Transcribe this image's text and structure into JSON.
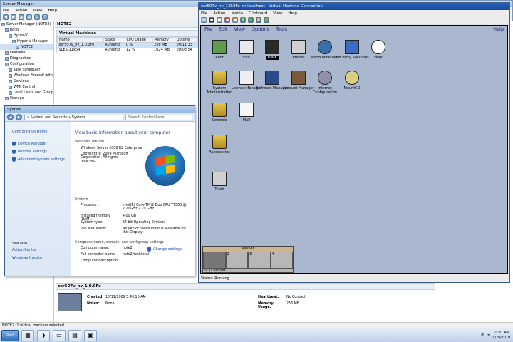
{
  "server_manager": {
    "title": "Server Manager",
    "menu": [
      "File",
      "Action",
      "View",
      "Help"
    ],
    "tree": [
      {
        "label": "Server Manager (NOTE2)",
        "indent": 0
      },
      {
        "label": "Roles",
        "indent": 1
      },
      {
        "label": "Hyper-V",
        "indent": 2
      },
      {
        "label": "Hyper-V Manager",
        "indent": 3
      },
      {
        "label": "NOTE2",
        "indent": 4
      },
      {
        "label": "Features",
        "indent": 1
      },
      {
        "label": "Diagnostics",
        "indent": 1
      },
      {
        "label": "Configuration",
        "indent": 1
      },
      {
        "label": "Task Scheduler",
        "indent": 2
      },
      {
        "label": "Windows Firewall with",
        "indent": 2
      },
      {
        "label": "Services",
        "indent": 2
      },
      {
        "label": "WMI Control",
        "indent": 2
      },
      {
        "label": "Local Users and Group",
        "indent": 2
      },
      {
        "label": "Storage",
        "indent": 1
      }
    ],
    "main_title": "NOTE2",
    "vm_section": "Virtual Machines",
    "vm_columns": [
      "Name",
      "State",
      "CPU Usage",
      "Memory",
      "Uptime"
    ],
    "vm_rows": [
      {
        "name": "osr507v_hv_1.0.0Fe",
        "state": "Running",
        "cpu": "0 %",
        "mem": "256 MB",
        "uptime": "00:11:33"
      },
      {
        "name": "SLES-11x64",
        "state": "Running",
        "cpu": "12 %",
        "mem": "1024 MB",
        "uptime": "00:08:54"
      }
    ],
    "detail": {
      "title": "osr507v_hv_1.0.0Fe",
      "created_label": "Created:",
      "created_value": "10/11/2009 5:49:10 AM",
      "notes_label": "Notes:",
      "notes_value": "None",
      "heartbeat_label": "Heartbeat:",
      "heartbeat_value": "No Contact",
      "memory_label": "Memory Usage:",
      "memory_value": "256 MB"
    },
    "status": "NOTE2:  1 virtual machine selected."
  },
  "system_window": {
    "title": "System",
    "address": "» System and Security » System",
    "search_placeholder": "Search Control Panel",
    "left_links": {
      "home": "Control Panel Home",
      "items": [
        "Device Manager",
        "Remote settings",
        "Advanced system settings"
      ],
      "see_also": "See also",
      "see_also_items": [
        "Action Center",
        "Windows Update"
      ]
    },
    "heading": "View basic information about your computer",
    "edition_group": "Windows edition",
    "edition": "Windows Server 2008 R2 Enterprise",
    "copyright": "Copyright © 2009 Microsoft Corporation.  All rights reserved.",
    "system_group": "System",
    "system_rows": [
      {
        "k": "Processor:",
        "v": "Intel(R) Core(TM)2 Duo CPU     T7500  @ 2.20GHz   2.20 GHz"
      },
      {
        "k": "Installed memory (RAM):",
        "v": "4.00 GB"
      },
      {
        "k": "System type:",
        "v": "64-bit Operating System"
      },
      {
        "k": "Pen and Touch:",
        "v": "No Pen or Touch Input is available for this Display"
      }
    ],
    "name_group": "Computer name, domain, and workgroup settings",
    "name_rows": [
      {
        "k": "Computer name:",
        "v": "note2"
      },
      {
        "k": "Full computer name:",
        "v": "note2.test.local"
      },
      {
        "k": "Computer description:",
        "v": ""
      }
    ],
    "change_settings": "Change settings"
  },
  "vm_connection": {
    "title": "osr507v_hv_1.0.0Fe on localhost - Virtual Machine Connection",
    "menu": [
      "File",
      "Action",
      "Media",
      "Clipboard",
      "View",
      "Help"
    ],
    "desktop_menu": [
      "File",
      "Edit",
      "View",
      "Options",
      "Tools"
    ],
    "desktop_help": "Help",
    "icons": [
      {
        "label": "Root",
        "kind": "root"
      },
      {
        "label": "Edit",
        "kind": "edit"
      },
      {
        "label": "UNIX",
        "kind": "unix"
      },
      {
        "label": "Printer",
        "kind": "printer"
      },
      {
        "label": "World Wide Web",
        "kind": "www"
      },
      {
        "label": "3rd Party Solutions",
        "kind": "sco"
      },
      {
        "label": "Help",
        "kind": "help"
      },
      {
        "label": "System Administration",
        "kind": "folder"
      },
      {
        "label": "License Manager",
        "kind": "license"
      },
      {
        "label": "Software Manager",
        "kind": "software"
      },
      {
        "label": "Account Manager",
        "kind": "account"
      },
      {
        "label": "Internet Configuration",
        "kind": "internet"
      },
      {
        "label": "MountCD",
        "kind": "cd"
      },
      {
        "label": "Controls",
        "kind": "folder"
      },
      {
        "label": "Mail",
        "kind": "mail"
      },
      {
        "label": "Accessories",
        "kind": "folder"
      },
      {
        "label": "Trash",
        "kind": "trash"
      }
    ],
    "panner_title": "Panner",
    "panner_cells": [
      "",
      "2",
      "3",
      "4"
    ],
    "panner_label": "SCO Panner",
    "status": "Status: Running"
  },
  "taskbar": {
    "start": "Start",
    "time": "10:31 AM",
    "date": "9/28/2010"
  }
}
